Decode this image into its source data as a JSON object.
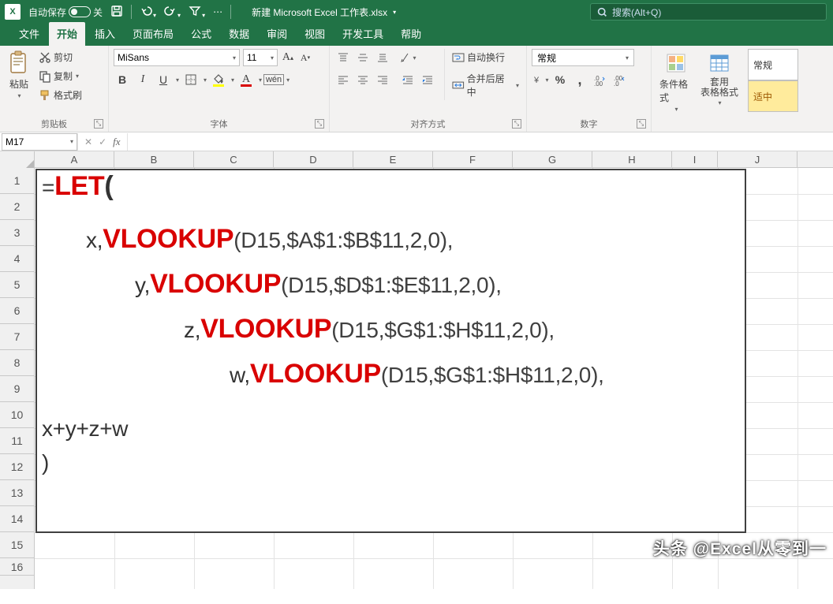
{
  "title": {
    "autosave": "自动保存",
    "autosave_state": "关",
    "docname": "新建 Microsoft Excel 工作表.xlsx"
  },
  "search": {
    "placeholder": "搜索(Alt+Q)"
  },
  "tabs": [
    "文件",
    "开始",
    "插入",
    "页面布局",
    "公式",
    "数据",
    "审阅",
    "视图",
    "开发工具",
    "帮助"
  ],
  "tab_active": 1,
  "ribbon": {
    "clipboard": {
      "paste": "粘贴",
      "cut": "剪切",
      "copy": "复制",
      "painter": "格式刷",
      "title": "剪贴板"
    },
    "font": {
      "name": "MiSans",
      "size": "11",
      "title": "字体"
    },
    "align": {
      "wrap": "自动换行",
      "merge": "合并后居中",
      "title": "对齐方式"
    },
    "number": {
      "format": "常规",
      "title": "数字"
    },
    "styles": {
      "cond": "条件格式",
      "table": "套用\n表格格式",
      "normal": "常规",
      "neutral": "适中"
    }
  },
  "namebox": "M17",
  "columns": [
    "A",
    "B",
    "C",
    "D",
    "E",
    "F",
    "G",
    "H",
    "I",
    "J"
  ],
  "rows": [
    "1",
    "2",
    "3",
    "4",
    "5",
    "6",
    "7",
    "8",
    "9",
    "10",
    "11",
    "12",
    "13",
    "14",
    "15",
    "16"
  ],
  "formula": {
    "eq": "=",
    "let": "LET",
    "open": "(",
    "l2a": "x,",
    "vl": "VLOOKUP",
    "l2b": "(D15,$A$1:$B$11,2,0),",
    "l3a": "y,",
    "l3b": "(D15,$D$1:$E$11,2,0),",
    "l4a": "z,",
    "l4b": "(D15,$G$1:$H$11,2,0),",
    "l5a": "w,",
    "l5b": "(D15,$G$1:$H$11,2,0),",
    "l6": "x+y+z+w",
    "l7": ")"
  },
  "watermark": "头条 @Excel从零到一"
}
